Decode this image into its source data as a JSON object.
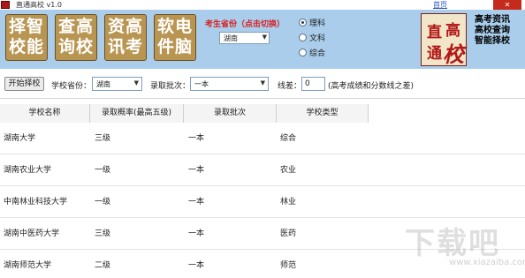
{
  "window": {
    "title": "直通高校 v1.0",
    "home_link": "首页",
    "close": "✕"
  },
  "header": {
    "tiles": [
      {
        "line1": "择智",
        "line2": "校能"
      },
      {
        "line1": "查高",
        "line2": "询校"
      },
      {
        "line1": "资高",
        "line2": "讯考"
      },
      {
        "line1": "软电",
        "line2": "件脑"
      }
    ],
    "province_prompt": "考生省份（点击切换）",
    "province_value": "湖南",
    "subjects": [
      {
        "label": "理科",
        "selected": true
      },
      {
        "label": "文科",
        "selected": false
      },
      {
        "label": "综合",
        "selected": false
      }
    ],
    "seal": {
      "c1": "直",
      "c2": "高",
      "c3": "通",
      "c4": "校"
    },
    "slogans": [
      "高考资讯",
      "高校查询",
      "智能择校"
    ]
  },
  "toolbar": {
    "start_button": "开始择校",
    "school_province_label": "学校省份：",
    "school_province_value": "湖南",
    "batch_label": "录取批次：",
    "batch_value": "一本",
    "diff_label": "线差：",
    "diff_value": "0",
    "diff_hint": "(高考成绩和分数线之差)"
  },
  "table": {
    "columns": [
      "学校名称",
      "录取概率(最高五级)",
      "录取批次",
      "学校类型"
    ],
    "rows": [
      [
        "湖南大学",
        "三级",
        "一本",
        "综合"
      ],
      [
        "湖南农业大学",
        "一级",
        "一本",
        "农业"
      ],
      [
        "中南林业科技大学",
        "一级",
        "一本",
        "林业"
      ],
      [
        "湖南中医药大学",
        "三级",
        "一本",
        "医药"
      ],
      [
        "湖南师范大学",
        "二级",
        "一本",
        "师范"
      ]
    ]
  },
  "watermark": {
    "main": "下载吧",
    "sub": "www.xiazaiba.com"
  }
}
